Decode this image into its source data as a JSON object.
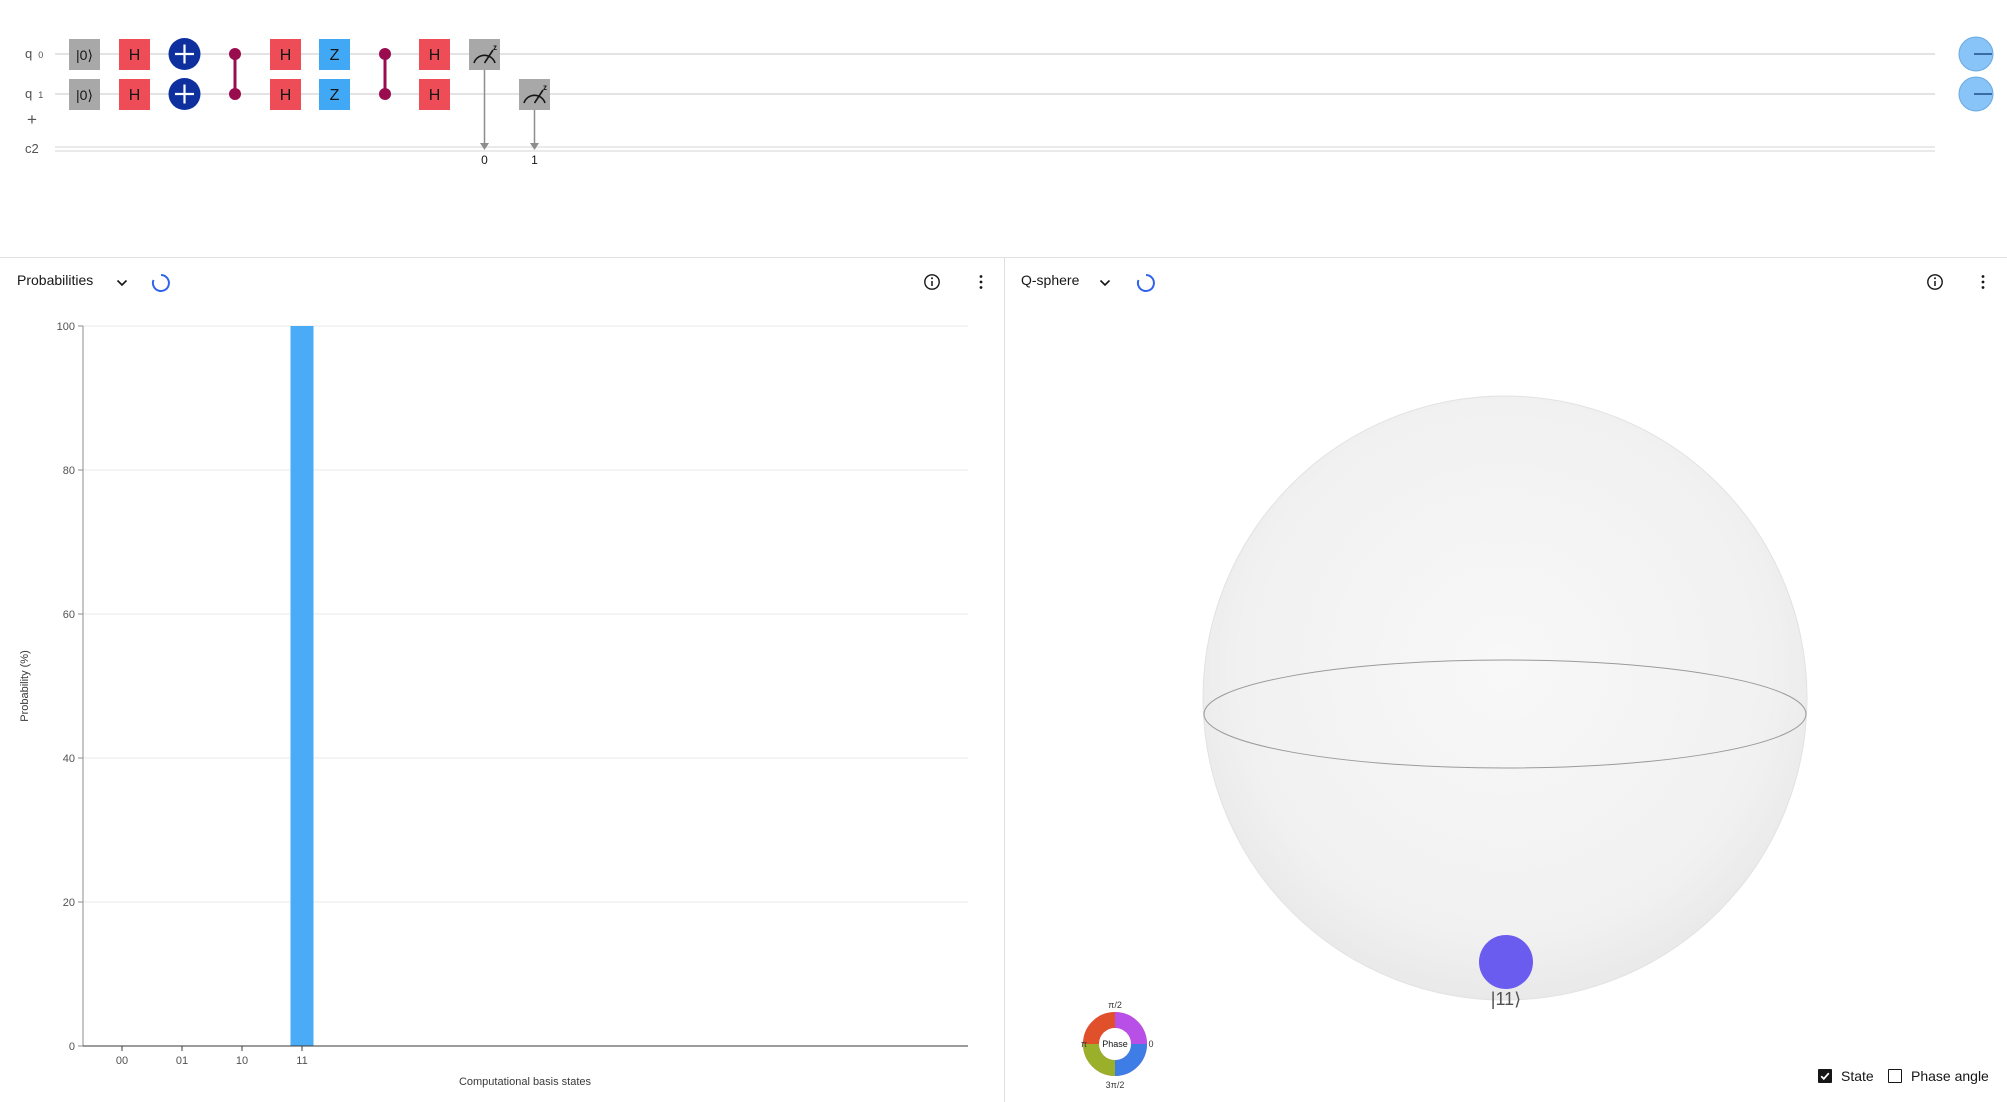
{
  "circuit": {
    "qubits": [
      {
        "label": "q",
        "index": "0"
      },
      {
        "label": "q",
        "index": "1"
      }
    ],
    "add_qubit": "+",
    "classical_register": "c2",
    "init_gate": "|0⟩",
    "h_gate": "H",
    "z_gate": "Z",
    "measure_labels": [
      "0",
      "1"
    ],
    "measure_basis": "z"
  },
  "probabilities_panel": {
    "title": "Probabilities"
  },
  "qsphere_panel": {
    "title": "Q-sphere",
    "state_label": "|11⟩",
    "phase_wheel": {
      "center": "Phase",
      "top": "π/2",
      "left": "π",
      "right": "0",
      "bottom": "3π/2"
    },
    "options": {
      "state": {
        "label": "State",
        "checked": true
      },
      "phase_angle": {
        "label": "Phase angle",
        "checked": false
      }
    }
  },
  "chart_data": {
    "type": "bar",
    "categories": [
      "00",
      "01",
      "10",
      "11"
    ],
    "values": [
      0,
      0,
      0,
      100
    ],
    "xlabel": "Computational basis states",
    "ylabel": "Probability (%)",
    "ylim": [
      0,
      100
    ],
    "yticks": [
      "0",
      "20",
      "40",
      "60",
      "80",
      "100"
    ],
    "grid": true,
    "bar_color": "#4aabf7"
  },
  "colors": {
    "gate_h": "#ee4d58",
    "gate_z": "#41a8f5",
    "gate_init": "#a8a8a8",
    "cnot": "#0e2f9e",
    "cz": "#990d4f",
    "state_marker": "#6b5cf0",
    "output_marker": "#88c4f7"
  }
}
